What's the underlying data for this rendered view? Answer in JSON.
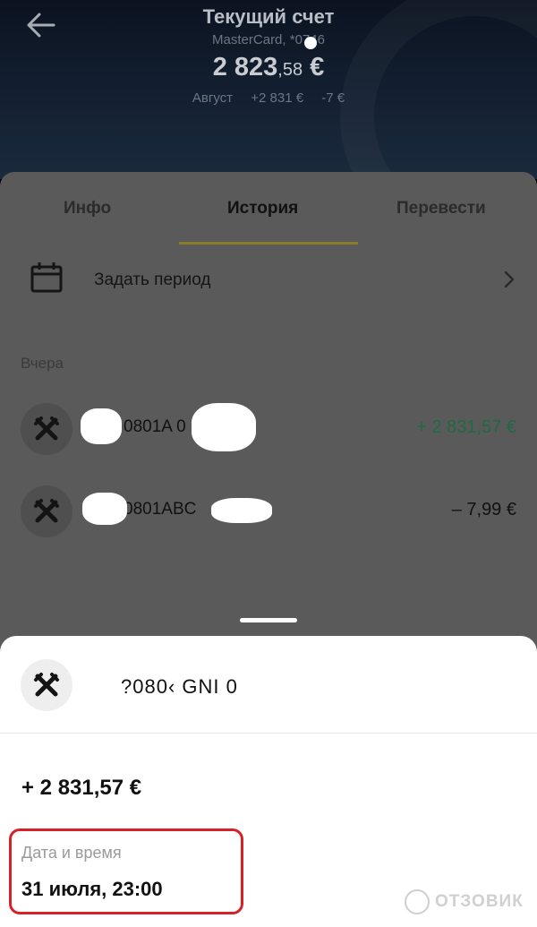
{
  "header": {
    "title": "Текущий счет",
    "subtitle": "MasterCard, *0746",
    "balance_main": "2 823",
    "balance_cents": ",58",
    "balance_currency": " €",
    "month": "Август",
    "income": "+2 831 €",
    "expense": "-7 €"
  },
  "tabs": [
    {
      "label": "Инфо"
    },
    {
      "label": "История"
    },
    {
      "label": "Перевести"
    }
  ],
  "period": {
    "label": "Задать период"
  },
  "history": {
    "section_label": "Вчера",
    "transactions": [
      {
        "name": "0801A   0",
        "amount": "+ 2 831,57 €"
      },
      {
        "name": "0801ABC",
        "amount": "– 7,99 €"
      }
    ]
  },
  "detail": {
    "name": "?080‹   GNI   0",
    "amount": "+ 2 831,57 €",
    "date_label": "Дата и время",
    "date_value": "31 июля, 23:00"
  },
  "watermark": {
    "text": "ОТЗОВИК"
  },
  "colors": {
    "positive": "#1e6a43",
    "highlight": "#d62128",
    "active_tab_underline": "#f7d21c"
  },
  "icons": {
    "back": "arrow-left-icon",
    "calendar": "calendar-icon",
    "chevron": "chevron-right-icon",
    "merchant": "crossed-tools-icon"
  }
}
